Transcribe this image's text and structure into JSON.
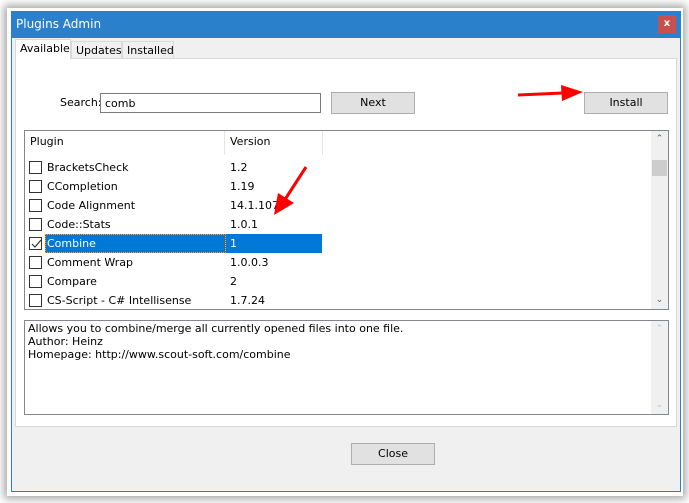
{
  "window": {
    "title": "Plugins Admin",
    "close_glyph": "x"
  },
  "tabs": [
    {
      "label": "Available",
      "active": true
    },
    {
      "label": "Updates",
      "active": false
    },
    {
      "label": "Installed",
      "active": false
    }
  ],
  "search": {
    "label": "Search:",
    "value": "comb"
  },
  "buttons": {
    "next": "Next",
    "install": "Install",
    "close": "Close"
  },
  "plugin_list": {
    "columns": [
      "Plugin",
      "Version"
    ],
    "rows": [
      {
        "name": "BracketsCheck",
        "version": "1.2",
        "checked": false,
        "selected": false
      },
      {
        "name": "CCompletion",
        "version": "1.19",
        "checked": false,
        "selected": false
      },
      {
        "name": "Code Alignment",
        "version": "14.1.107",
        "checked": false,
        "selected": false
      },
      {
        "name": "Code::Stats",
        "version": "1.0.1",
        "checked": false,
        "selected": false
      },
      {
        "name": "Combine",
        "version": "1",
        "checked": true,
        "selected": true
      },
      {
        "name": "Comment Wrap",
        "version": "1.0.0.3",
        "checked": false,
        "selected": false
      },
      {
        "name": "Compare",
        "version": "2",
        "checked": false,
        "selected": false
      },
      {
        "name": "CS-Script - C# Intellisense",
        "version": "1.7.24",
        "checked": false,
        "selected": false
      }
    ]
  },
  "description": {
    "lines": [
      "Allows you to combine/merge all currently opened files into one file.",
      "Author: Heinz",
      "Homepage: http://www.scout-soft.com/combine"
    ]
  },
  "scroll_glyphs": {
    "up": "^",
    "down": "v"
  },
  "colors": {
    "titlebar": "#2b80cc",
    "selection": "#0078d7",
    "close_button": "#c8504d",
    "annotation_arrow": "#ff0000"
  }
}
